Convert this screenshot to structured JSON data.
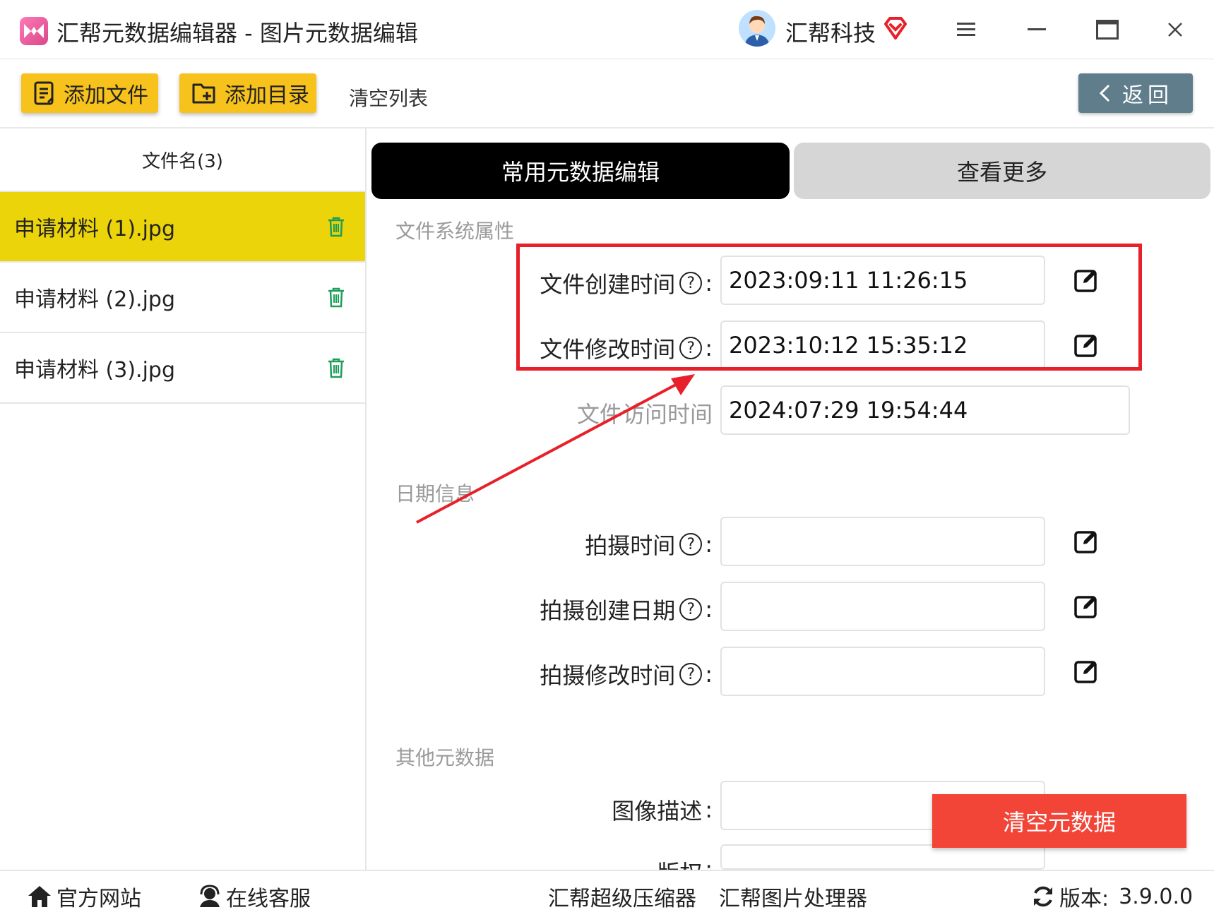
{
  "window": {
    "title": "汇帮元数据编辑器 - 图片元数据编辑",
    "brand_name": "汇帮科技"
  },
  "toolbar": {
    "add_file": "添加文件",
    "add_dir": "添加目录",
    "clear_list": "清空列表",
    "back": "返回"
  },
  "file_list": {
    "header": "文件名(3)",
    "items": [
      {
        "name": "申请材料 (1).jpg",
        "selected": true
      },
      {
        "name": "申请材料 (2).jpg",
        "selected": false
      },
      {
        "name": "申请材料 (3).jpg",
        "selected": false
      }
    ]
  },
  "tabs": {
    "common": "常用元数据编辑",
    "more": "查看更多"
  },
  "sections": {
    "fs": {
      "title": "文件系统属性",
      "create_label": "文件创建时间",
      "create_value": "2023:09:11 11:26:15",
      "modify_label": "文件修改时间",
      "modify_value": "2023:10:12 15:35:12",
      "access_label": "文件访问时间",
      "access_value": "2024:07:29 19:54:44"
    },
    "date": {
      "title": "日期信息",
      "shot_label": "拍摄时间",
      "shot_value": "",
      "shot_create_label": "拍摄创建日期",
      "shot_create_value": "",
      "shot_modify_label": "拍摄修改时间",
      "shot_modify_value": ""
    },
    "other": {
      "title": "其他元数据",
      "desc_label": "图像描述",
      "desc_value": "",
      "copyright_label": "版权",
      "copyright_value": ""
    }
  },
  "actions": {
    "clear_meta": "清空元数据"
  },
  "footer": {
    "website": "官方网站",
    "support": "在线客服",
    "compressor": "汇帮超级压缩器",
    "image_proc": "汇帮图片处理器",
    "version_label": "版本:",
    "version_value": "3.9.0.0"
  },
  "colors": {
    "accent_yellow": "#f7c21b",
    "selected_row": "#ecd40a",
    "danger_red": "#f24437",
    "highlight_box": "#e8202a",
    "back_button": "#607d8b"
  }
}
